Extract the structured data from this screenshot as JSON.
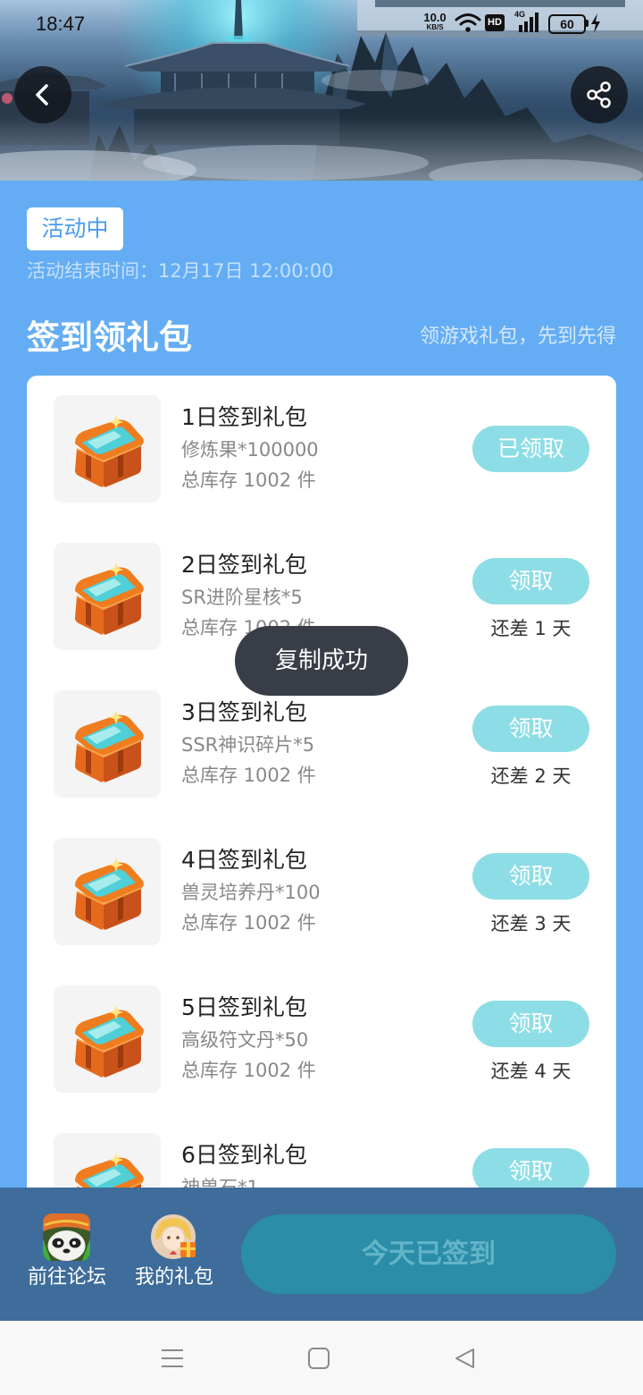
{
  "status_bar": {
    "time": "18:47",
    "net_speed": "10.0",
    "net_speed_unit": "KB/S",
    "hd_badge": "HD",
    "network_type": "4G",
    "battery_level": "60"
  },
  "icons": {
    "back": "chevron-left-icon",
    "share": "share-icon",
    "gift_image": "treasure-chest-icon",
    "forum": "game-app-icon",
    "my_gifts": "avatar-gift-icon",
    "nav_menu": "menu-icon",
    "nav_home": "square-home-icon",
    "nav_back": "triangle-back-icon"
  },
  "activity": {
    "status_badge": "活动中",
    "end_time": "活动结束时间：12月17日 12:00:00"
  },
  "section": {
    "title": "签到领礼包",
    "subtitle": "领游戏礼包，先到先得"
  },
  "gifts": [
    {
      "title": "1日签到礼包",
      "content": "修炼果*100000",
      "stock": "总库存 1002 件",
      "button": "已领取"
    },
    {
      "title": "2日签到礼包",
      "content": "SR进阶星核*5",
      "stock": "总库存 1002 件",
      "button": "领取",
      "remaining": "还差 1 天"
    },
    {
      "title": "3日签到礼包",
      "content": "SSR神识碎片*5",
      "stock": "总库存 1002 件",
      "button": "领取",
      "remaining": "还差 2 天"
    },
    {
      "title": "4日签到礼包",
      "content": "兽灵培养丹*100",
      "stock": "总库存 1002 件",
      "button": "领取",
      "remaining": "还差 3 天"
    },
    {
      "title": "5日签到礼包",
      "content": "高级符文丹*50",
      "stock": "总库存 1002 件",
      "button": "领取",
      "remaining": "还差 4 天"
    },
    {
      "title": "6日签到礼包",
      "content": "神兽石*1",
      "button": "领取"
    }
  ],
  "toast": {
    "message": "复制成功"
  },
  "bottom_bar": {
    "forum_label": "前往论坛",
    "my_gifts_label": "我的礼包",
    "checkin_button": "今天已签到"
  },
  "colors": {
    "page_bg": "#64adf4",
    "gift_button_bg": "#8ddde6",
    "bottom_bar_bg": "#3e6c9b",
    "checkin_button_bg": "#2b8da7",
    "toast_bg": "#383d47"
  }
}
